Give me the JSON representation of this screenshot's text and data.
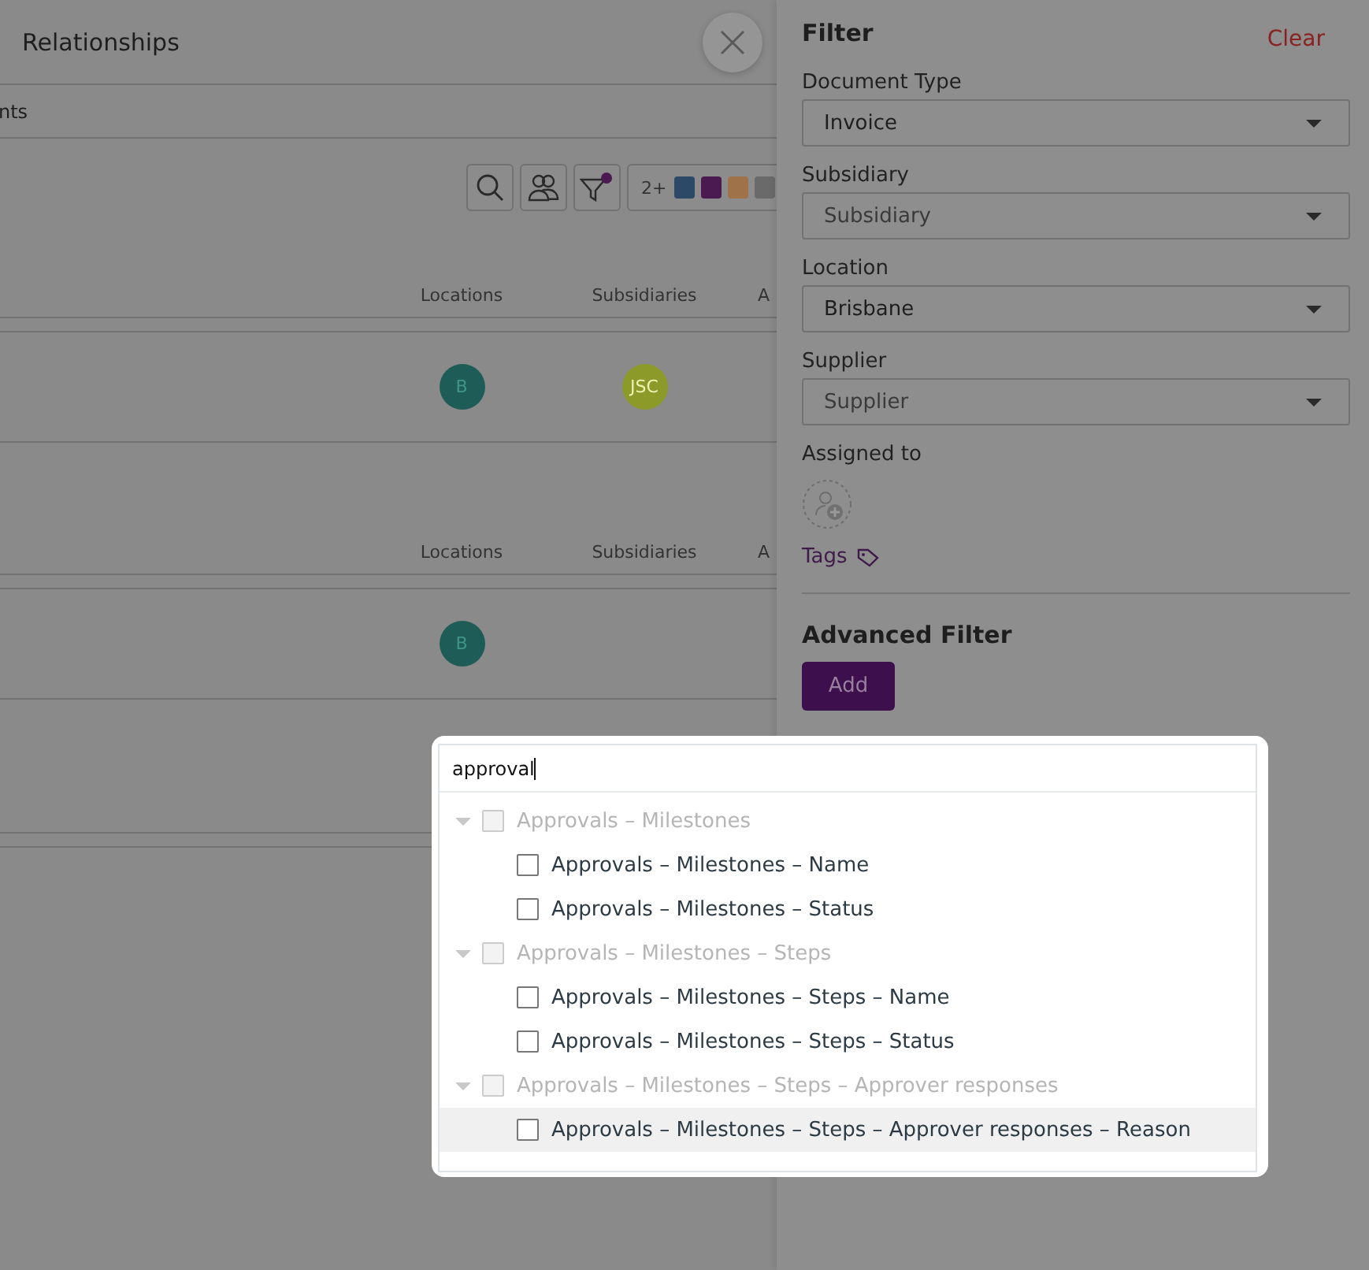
{
  "page": {
    "title": "Relationships",
    "tab_fragment": "nts"
  },
  "toolbar": {
    "count": "2+",
    "chips": [
      {
        "color": "#2c4a68"
      },
      {
        "color": "#4a1a50"
      },
      {
        "color": "#a0724a"
      },
      {
        "color": "#6a6a6a"
      }
    ]
  },
  "sections": [
    {
      "columns": [
        "Locations",
        "Subsidiaries",
        "A"
      ],
      "rows": [
        {
          "cells": [
            {
              "text": "B",
              "color": "#1e5c57"
            },
            {
              "text": "JSC",
              "color": "#8c9a2a"
            }
          ]
        }
      ]
    },
    {
      "columns": [
        "Locations",
        "Subsidiaries",
        "A"
      ],
      "rows": [
        {
          "cells": [
            {
              "text": "B",
              "color": "#1e5c57"
            }
          ]
        }
      ]
    }
  ],
  "filter": {
    "title": "Filter",
    "clear": "Clear",
    "fields": [
      {
        "label": "Document Type",
        "value": "Invoice"
      },
      {
        "label": "Subsidiary",
        "placeholder": "Subsidiary"
      },
      {
        "label": "Location",
        "value": "Brisbane"
      },
      {
        "label": "Supplier",
        "placeholder": "Supplier"
      }
    ],
    "assigned_label": "Assigned to",
    "tags_label": "Tags",
    "advanced_title": "Advanced Filter",
    "add_button": "Add"
  },
  "popup": {
    "search_value": "approval",
    "groups": [
      {
        "label": "Approvals – Milestones",
        "expanded": true,
        "disabled": true,
        "children": [
          {
            "label": "Approvals – Milestones – Name",
            "checked": false,
            "highlighted": false
          },
          {
            "label": "Approvals – Milestones – Status",
            "checked": false,
            "highlighted": false
          }
        ]
      },
      {
        "label": "Approvals – Milestones – Steps",
        "expanded": true,
        "disabled": true,
        "children": [
          {
            "label": "Approvals – Milestones – Steps – Name",
            "checked": false,
            "highlighted": false
          },
          {
            "label": "Approvals – Milestones – Steps – Status",
            "checked": false,
            "highlighted": false
          }
        ]
      },
      {
        "label": "Approvals – Milestones – Steps – Approver responses",
        "expanded": true,
        "disabled": true,
        "children": [
          {
            "label": "Approvals – Milestones – Steps – Approver responses – Reason",
            "checked": false,
            "highlighted": true
          }
        ]
      }
    ]
  }
}
